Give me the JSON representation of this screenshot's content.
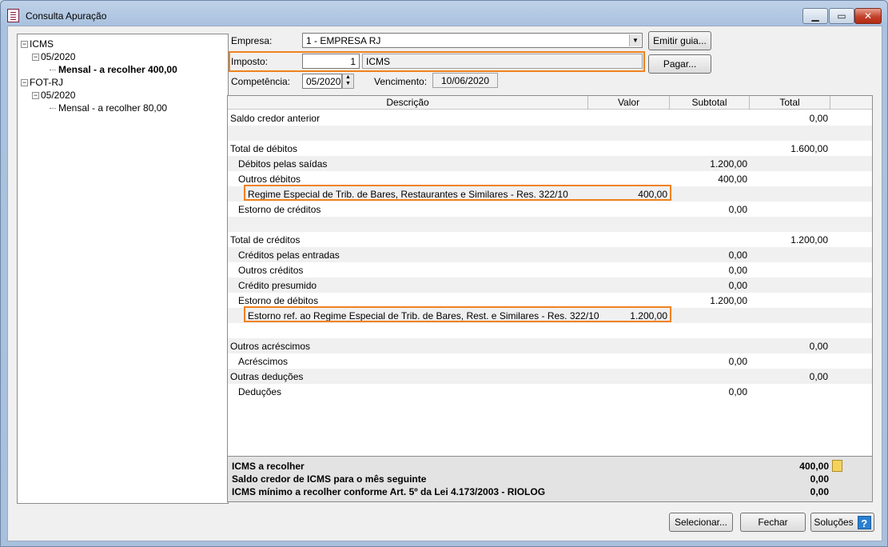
{
  "window": {
    "title": "Consulta Apuração"
  },
  "tree": [
    {
      "label": "ICMS",
      "level": 0,
      "expander": "−"
    },
    {
      "label": "05/2020",
      "level": 1,
      "expander": "−"
    },
    {
      "label": "Mensal - a recolher 400,00",
      "level": 2,
      "selected": true
    },
    {
      "label": "FOT-RJ",
      "level": 0,
      "expander": "−"
    },
    {
      "label": "05/2020",
      "level": 1,
      "expander": "−"
    },
    {
      "label": "Mensal - a recolher 80,00",
      "level": 2,
      "selected": false
    }
  ],
  "form": {
    "empresa_label": "Empresa:",
    "empresa_value": "1 - EMPRESA RJ",
    "imposto_label": "Imposto:",
    "imposto_code": "1",
    "imposto_name": "ICMS",
    "competencia_label": "Competência:",
    "competencia_value": "05/2020",
    "vencimento_label": "Vencimento:",
    "vencimento_value": "10/06/2020"
  },
  "buttons": {
    "emitir_guia": "Emitir guia...",
    "pagar": "Pagar...",
    "selecionar": "Selecionar...",
    "fechar": "Fechar",
    "solucoes": "Soluções"
  },
  "grid": {
    "columns": [
      "Descrição",
      "Valor",
      "Subtotal",
      "Total"
    ],
    "rows": [
      {
        "desc": "Saldo credor anterior",
        "indent": 0,
        "valor": "",
        "subtotal": "",
        "total": "0,00"
      },
      {
        "desc": "",
        "indent": 0,
        "valor": "",
        "subtotal": "",
        "total": ""
      },
      {
        "desc": "Total de débitos",
        "indent": 0,
        "valor": "",
        "subtotal": "",
        "total": "1.600,00"
      },
      {
        "desc": "Débitos pelas saídas",
        "indent": 1,
        "valor": "",
        "subtotal": "1.200,00",
        "total": ""
      },
      {
        "desc": "Outros débitos",
        "indent": 1,
        "valor": "",
        "subtotal": "400,00",
        "total": ""
      },
      {
        "desc": "Regime Especial de Trib. de Bares, Restaurantes e Similares - Res. 322/10",
        "indent": 2,
        "valor": "400,00",
        "subtotal": "",
        "total": ""
      },
      {
        "desc": "Estorno de créditos",
        "indent": 1,
        "valor": "",
        "subtotal": "0,00",
        "total": ""
      },
      {
        "desc": "",
        "indent": 0,
        "valor": "",
        "subtotal": "",
        "total": ""
      },
      {
        "desc": "Total de créditos",
        "indent": 0,
        "valor": "",
        "subtotal": "",
        "total": "1.200,00"
      },
      {
        "desc": "Créditos pelas entradas",
        "indent": 1,
        "valor": "",
        "subtotal": "0,00",
        "total": ""
      },
      {
        "desc": "Outros créditos",
        "indent": 1,
        "valor": "",
        "subtotal": "0,00",
        "total": ""
      },
      {
        "desc": "Crédito presumido",
        "indent": 1,
        "valor": "",
        "subtotal": "0,00",
        "total": ""
      },
      {
        "desc": "Estorno de débitos",
        "indent": 1,
        "valor": "",
        "subtotal": "1.200,00",
        "total": ""
      },
      {
        "desc": "Estorno ref. ao Regime Especial de Trib. de Bares, Rest. e Similares - Res. 322/10",
        "indent": 2,
        "valor": "1.200,00",
        "subtotal": "",
        "total": ""
      },
      {
        "desc": "",
        "indent": 0,
        "valor": "",
        "subtotal": "",
        "total": ""
      },
      {
        "desc": "Outros acréscimos",
        "indent": 0,
        "valor": "",
        "subtotal": "",
        "total": "0,00"
      },
      {
        "desc": "Acréscimos",
        "indent": 1,
        "valor": "",
        "subtotal": "0,00",
        "total": ""
      },
      {
        "desc": "Outras deduções",
        "indent": 0,
        "valor": "",
        "subtotal": "",
        "total": "0,00"
      },
      {
        "desc": "Deduções",
        "indent": 1,
        "valor": "",
        "subtotal": "0,00",
        "total": ""
      }
    ]
  },
  "summary": [
    {
      "label": "ICMS a recolher",
      "value": "400,00",
      "icon": true
    },
    {
      "label": "Saldo credor de ICMS para o mês seguinte",
      "value": "0,00",
      "icon": false
    },
    {
      "label": "ICMS mínimo a recolher conforme Art. 5º da Lei 4.173/2003 - RIOLOG",
      "value": "0,00",
      "icon": false
    }
  ],
  "colors": {
    "highlight": "#f0821e",
    "accent": "#2a7fd1"
  }
}
